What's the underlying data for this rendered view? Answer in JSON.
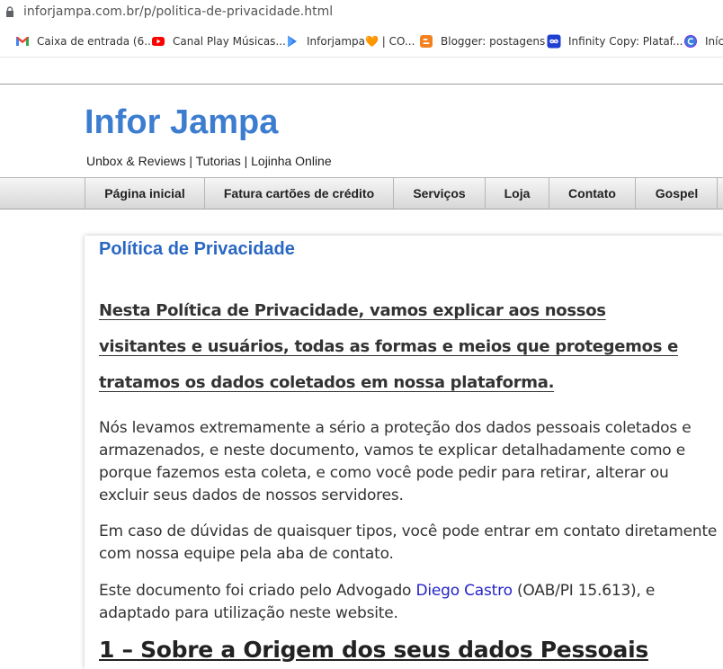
{
  "browser": {
    "url": "inforjampa.com.br/p/politica-de-privacidade.html",
    "bookmarks": [
      {
        "label": "Caixa de entrada (6...",
        "icon": "gmail-icon"
      },
      {
        "label": "Canal Play Músicas...",
        "icon": "youtube-icon"
      },
      {
        "label": "Inforjampa🧡 | CO...",
        "icon": "play-store-icon"
      },
      {
        "label": "Blogger: postagens",
        "icon": "blogger-icon"
      },
      {
        "label": "Infinity Copy: Plataf...",
        "icon": "infinity-icon"
      },
      {
        "label": "Iníc",
        "icon": "canva-icon"
      }
    ]
  },
  "site": {
    "title": "Infor Jampa",
    "description": "Unbox & Reviews | Tutorias | Lojinha Online",
    "nav": [
      "Página inicial",
      "Fatura cartões de crédito",
      "Serviços",
      "Loja",
      "Contato",
      "Gospel"
    ]
  },
  "post": {
    "title": "Política de Privacidade",
    "intro": "Nesta Política de Privacidade, vamos explicar aos nossos visitantes e usuários, todas as formas e meios que protegemos e tratamos os dados coletados em nossa plataforma.",
    "p1": "Nós levamos extremamente a sério a proteção dos dados pessoais coletados e armazenados, e neste documento, vamos te explicar detalhadamente como e porque fazemos esta coleta, e como você pode pedir para retirar, alterar ou excluir seus dados de nossos servidores.",
    "p2": "Em caso de dúvidas de quaisquer tipos, você pode entrar em contato diretamente com nossa equipe pela aba de contato.",
    "p3_before": "Este documento foi criado pelo Advogado ",
    "p3_link": "Diego Castro",
    "p3_after": " (OAB/PI 15.613), e adaptado para utilização neste website.",
    "section1": "1 – Sobre a Origem dos seus dados Pessoais"
  },
  "colors": {
    "title_blue": "#3d7dd0",
    "post_title_blue": "#2a67c3",
    "link_blue": "#2424c8"
  }
}
